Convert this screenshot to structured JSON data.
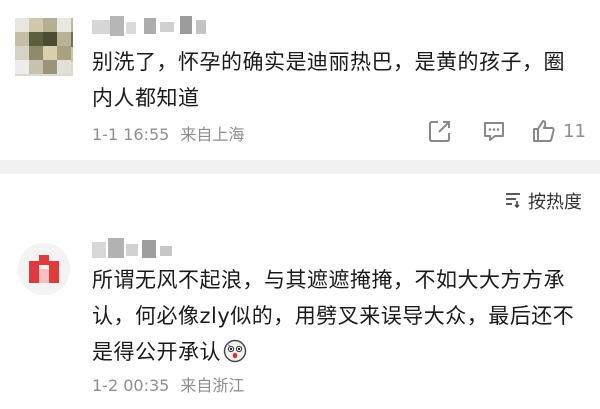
{
  "comments": [
    {
      "text": "别洗了，怀孕的确实是迪丽热巴，是黄的孩子，圈内人都知道",
      "time": "1-1 16:55",
      "location": "来自上海",
      "like_count": "11",
      "icons": [
        "share-icon",
        "comment-icon",
        "like-icon"
      ]
    },
    {
      "text": "所谓无风不起浪，与其遮遮掩掩，不如大大方方承认，何必像zly似的，用劈叉来误导大众，最后还不是得公开承认",
      "time": "1-2 00:35",
      "location": "来自浙江",
      "emoji": "shocked-face-emoji"
    }
  ],
  "sort": {
    "label": "按热度",
    "icon": "sort-icon"
  },
  "colors": {
    "text": "#1a1a1a",
    "meta": "#8e8e8e",
    "divider": "#f0f0f0",
    "avatar_red": "#e23a3a"
  }
}
